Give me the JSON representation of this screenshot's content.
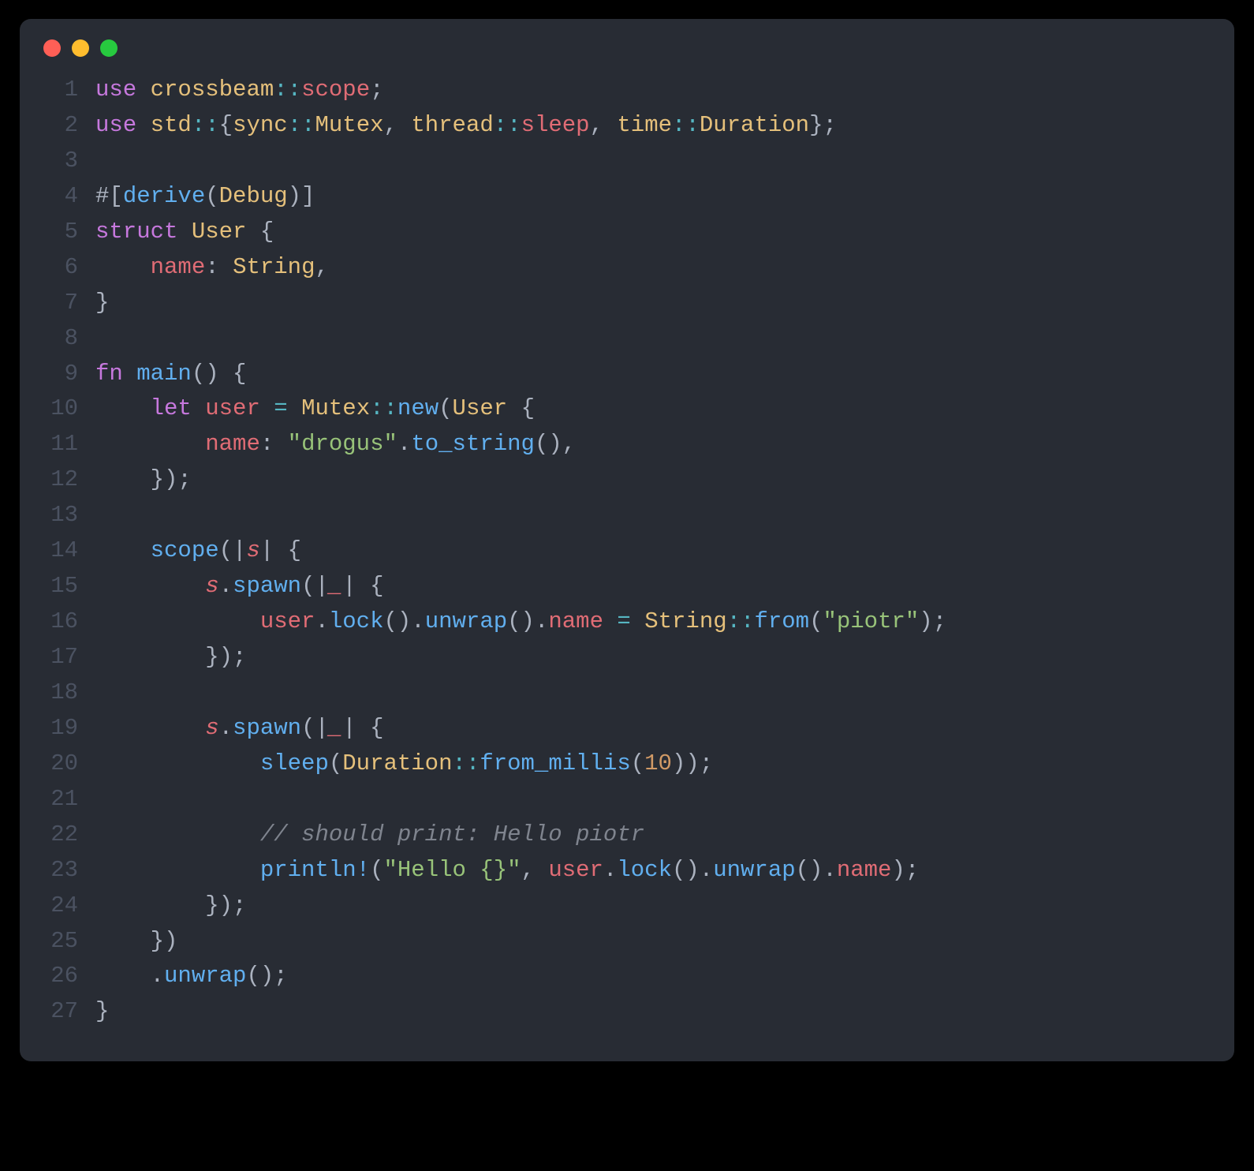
{
  "window": {
    "dots": [
      "red",
      "yellow",
      "green"
    ]
  },
  "code": {
    "line_numbers": [
      "1",
      "2",
      "3",
      "4",
      "5",
      "6",
      "7",
      "8",
      "9",
      "10",
      "11",
      "12",
      "13",
      "14",
      "15",
      "16",
      "17",
      "18",
      "19",
      "20",
      "21",
      "22",
      "23",
      "24",
      "25",
      "26",
      "27"
    ],
    "tokens": [
      [
        [
          "kw",
          "use "
        ],
        [
          "ns",
          "crossbeam"
        ],
        [
          "op",
          "::"
        ],
        [
          "var",
          "scope"
        ],
        [
          "pun",
          ";"
        ]
      ],
      [
        [
          "kw",
          "use "
        ],
        [
          "ns",
          "std"
        ],
        [
          "op",
          "::"
        ],
        [
          "pun",
          "{"
        ],
        [
          "ns",
          "sync"
        ],
        [
          "op",
          "::"
        ],
        [
          "ns",
          "Mutex"
        ],
        [
          "pun",
          ", "
        ],
        [
          "ns",
          "thread"
        ],
        [
          "op",
          "::"
        ],
        [
          "var",
          "sleep"
        ],
        [
          "pun",
          ", "
        ],
        [
          "ns",
          "time"
        ],
        [
          "op",
          "::"
        ],
        [
          "ns",
          "Duration"
        ],
        [
          "pun",
          "};"
        ]
      ],
      [],
      [
        [
          "pun",
          "#["
        ],
        [
          "func",
          "derive"
        ],
        [
          "pun",
          "("
        ],
        [
          "ns",
          "Debug"
        ],
        [
          "pun",
          ")]"
        ]
      ],
      [
        [
          "kw",
          "struct "
        ],
        [
          "ns",
          "User"
        ],
        [
          "pun",
          " {"
        ]
      ],
      [
        [
          "wht",
          "    "
        ],
        [
          "prop",
          "name"
        ],
        [
          "pun",
          ": "
        ],
        [
          "ns",
          "String"
        ],
        [
          "pun",
          ","
        ]
      ],
      [
        [
          "pun",
          "}"
        ]
      ],
      [],
      [
        [
          "kw",
          "fn "
        ],
        [
          "func",
          "main"
        ],
        [
          "pun",
          "() {"
        ]
      ],
      [
        [
          "wht",
          "    "
        ],
        [
          "kw",
          "let "
        ],
        [
          "var",
          "user"
        ],
        [
          "wht",
          " "
        ],
        [
          "op",
          "="
        ],
        [
          "wht",
          " "
        ],
        [
          "ns",
          "Mutex"
        ],
        [
          "op",
          "::"
        ],
        [
          "func",
          "new"
        ],
        [
          "pun",
          "("
        ],
        [
          "ns",
          "User"
        ],
        [
          "pun",
          " {"
        ]
      ],
      [
        [
          "wht",
          "        "
        ],
        [
          "prop",
          "name"
        ],
        [
          "pun",
          ": "
        ],
        [
          "str",
          "\"drogus\""
        ],
        [
          "pun",
          "."
        ],
        [
          "func",
          "to_string"
        ],
        [
          "pun",
          "(),"
        ]
      ],
      [
        [
          "wht",
          "    "
        ],
        [
          "pun",
          "});"
        ]
      ],
      [],
      [
        [
          "wht",
          "    "
        ],
        [
          "func",
          "scope"
        ],
        [
          "pun",
          "(|"
        ],
        [
          "varit",
          "s"
        ],
        [
          "pun",
          "| {"
        ]
      ],
      [
        [
          "wht",
          "        "
        ],
        [
          "varit",
          "s"
        ],
        [
          "pun",
          "."
        ],
        [
          "func",
          "spawn"
        ],
        [
          "pun",
          "(|"
        ],
        [
          "varit",
          "_"
        ],
        [
          "pun",
          "| {"
        ]
      ],
      [
        [
          "wht",
          "            "
        ],
        [
          "var",
          "user"
        ],
        [
          "pun",
          "."
        ],
        [
          "func",
          "lock"
        ],
        [
          "pun",
          "()."
        ],
        [
          "func",
          "unwrap"
        ],
        [
          "pun",
          "()."
        ],
        [
          "prop",
          "name"
        ],
        [
          "wht",
          " "
        ],
        [
          "op",
          "="
        ],
        [
          "wht",
          " "
        ],
        [
          "ns",
          "String"
        ],
        [
          "op",
          "::"
        ],
        [
          "func",
          "from"
        ],
        [
          "pun",
          "("
        ],
        [
          "str",
          "\"piotr\""
        ],
        [
          "pun",
          ");"
        ]
      ],
      [
        [
          "wht",
          "        "
        ],
        [
          "pun",
          "});"
        ]
      ],
      [],
      [
        [
          "wht",
          "        "
        ],
        [
          "varit",
          "s"
        ],
        [
          "pun",
          "."
        ],
        [
          "func",
          "spawn"
        ],
        [
          "pun",
          "(|"
        ],
        [
          "varit",
          "_"
        ],
        [
          "pun",
          "| {"
        ]
      ],
      [
        [
          "wht",
          "            "
        ],
        [
          "func",
          "sleep"
        ],
        [
          "pun",
          "("
        ],
        [
          "ns",
          "Duration"
        ],
        [
          "op",
          "::"
        ],
        [
          "func",
          "from_millis"
        ],
        [
          "pun",
          "("
        ],
        [
          "num",
          "10"
        ],
        [
          "pun",
          "));"
        ]
      ],
      [],
      [
        [
          "wht",
          "            "
        ],
        [
          "cmt",
          "// should print: Hello piotr"
        ]
      ],
      [
        [
          "wht",
          "            "
        ],
        [
          "func",
          "println!"
        ],
        [
          "pun",
          "("
        ],
        [
          "str",
          "\"Hello {}\""
        ],
        [
          "pun",
          ", "
        ],
        [
          "var",
          "user"
        ],
        [
          "pun",
          "."
        ],
        [
          "func",
          "lock"
        ],
        [
          "pun",
          "()."
        ],
        [
          "func",
          "unwrap"
        ],
        [
          "pun",
          "()."
        ],
        [
          "prop",
          "name"
        ],
        [
          "pun",
          ");"
        ]
      ],
      [
        [
          "wht",
          "        "
        ],
        [
          "pun",
          "});"
        ]
      ],
      [
        [
          "wht",
          "    "
        ],
        [
          "pun",
          "})"
        ]
      ],
      [
        [
          "wht",
          "    "
        ],
        [
          "pun",
          "."
        ],
        [
          "func",
          "unwrap"
        ],
        [
          "pun",
          "();"
        ]
      ],
      [
        [
          "pun",
          "}"
        ]
      ]
    ]
  }
}
